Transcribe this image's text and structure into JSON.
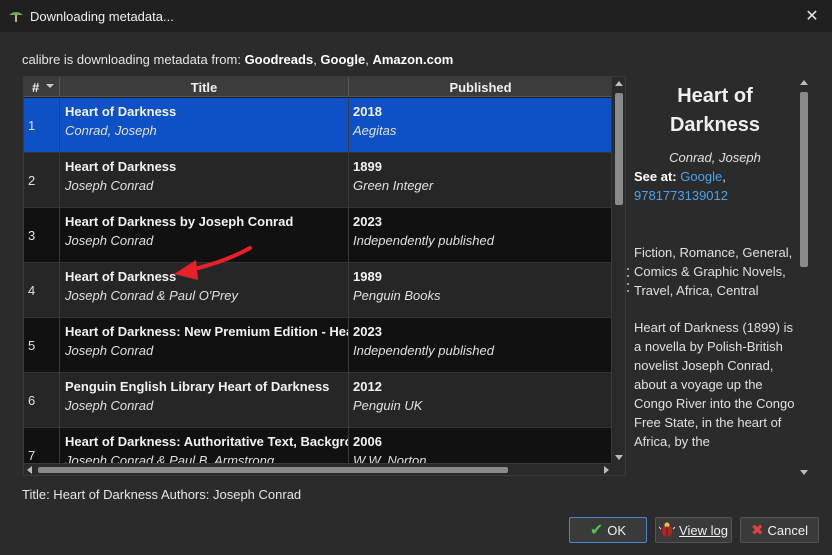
{
  "window": {
    "title": "Downloading metadata...",
    "icon": "calibre-icon",
    "close_glyph": "✕"
  },
  "source_line": {
    "prefix": "calibre is downloading metadata from: ",
    "sources": [
      "Goodreads",
      "Google",
      "Amazon.com"
    ],
    "sep": ", "
  },
  "table": {
    "columns": {
      "num": "#",
      "title": "Title",
      "published": "Published"
    },
    "rows": [
      {
        "num": "1",
        "title": "Heart of Darkness",
        "author": "Conrad, Joseph",
        "year": "2018",
        "publisher": "Aegitas",
        "selected": true
      },
      {
        "num": "2",
        "title": "Heart of Darkness",
        "author": "Joseph Conrad",
        "year": "1899",
        "publisher": "Green Integer"
      },
      {
        "num": "3",
        "title": "Heart of Darkness by Joseph Conrad",
        "author": "Joseph Conrad",
        "year": "2023",
        "publisher": "Independently published"
      },
      {
        "num": "4",
        "title": "Heart of Darkness",
        "author": "Joseph Conrad & Paul O'Prey",
        "year": "1989",
        "publisher": "Penguin Books"
      },
      {
        "num": "5",
        "title": "Heart of Darkness: New Premium Edition - Hea",
        "author": "Joseph Conrad",
        "year": "2023",
        "publisher": "Independently published"
      },
      {
        "num": "6",
        "title": "Penguin English Library Heart of Darkness",
        "author": "Joseph Conrad",
        "year": "2012",
        "publisher": "Penguin UK"
      },
      {
        "num": "7",
        "title": "Heart of Darkness: Authoritative Text, Backgro",
        "author": "Joseph Conrad & Paul B. Armstrong",
        "year": "2006",
        "publisher": "W.W. Norton"
      }
    ]
  },
  "details": {
    "title": "Heart of Darkness",
    "author": "Conrad, Joseph",
    "see_at_label": "See at:",
    "links": [
      "Google",
      "9781773139012"
    ],
    "genres": "Fiction, Romance, General, Comics & Graphic Novels, Travel, Africa, Central",
    "description": "Heart of Darkness (1899) is a novella by Polish-British novelist Joseph Conrad, about a voyage up the Congo River into the Congo Free State, in the heart of Africa, by the"
  },
  "summary": "Title: Heart of Darkness Authors: Joseph Conrad",
  "buttons": {
    "ok": "OK",
    "view_log": "View log",
    "cancel": "Cancel"
  },
  "colors": {
    "selection": "#0e50c6",
    "link": "#4aa3f0",
    "annotation_arrow": "#e8202a"
  }
}
